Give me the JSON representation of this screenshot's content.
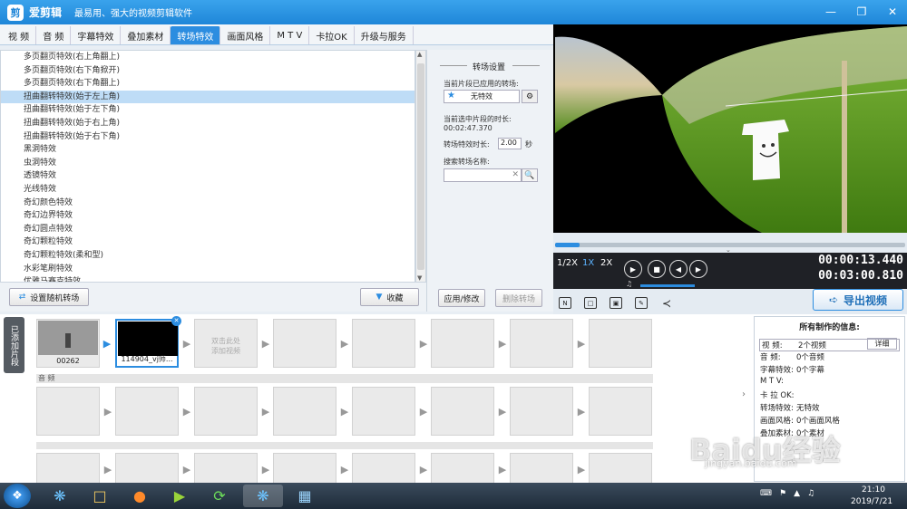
{
  "app": {
    "name": "爱剪辑",
    "slogan": "最易用、强大的视频剪辑软件",
    "logo_char": "剪"
  },
  "tabs": [
    "视 频",
    "音 频",
    "字幕特效",
    "叠加素材",
    "转场特效",
    "画面风格",
    "M T V",
    "卡拉OK",
    "升级与服务"
  ],
  "active_tab": 4,
  "effects": [
    "多页翻页特效(右上角翻上)",
    "多页翻页特效(右下角掀开)",
    "多页翻页特效(右下角翻上)",
    "扭曲翻转特效(始于左上角)",
    "扭曲翻转特效(始于左下角)",
    "扭曲翻转特效(始于右上角)",
    "扭曲翻转特效(始于右下角)",
    "黑洞特效",
    "虫洞特效",
    "透镜特效",
    "光线特效",
    "奇幻颜色特效",
    "奇幻边界特效",
    "奇幻圆点特效",
    "奇幻颗粒特效",
    "奇幻颗粒特效(柔和型)",
    "水彩笔刷特效",
    "优雅马赛克特效"
  ],
  "selected_effect": 3,
  "left_buttons": {
    "random": "设置随机转场",
    "favorite": "收藏"
  },
  "settings": {
    "title": "转场设置",
    "applied_label": "当前片段已应用的转场:",
    "applied_value": "无特效",
    "duration_label": "当前选中片段的时长:",
    "duration_value": "00:02:47.370",
    "effect_time_label": "转场特效时长:",
    "effect_time_value": "2.00",
    "effect_time_unit": "秒",
    "search_label": "搜索转场名称:",
    "search_value": "",
    "apply_button": "应用/修改",
    "delete_button": "删除转场"
  },
  "player": {
    "progress": 0.07,
    "speeds": [
      "1/2X",
      "1X",
      "2X"
    ],
    "active_speed": "1X",
    "time_current": "00:00:13.440",
    "time_total": "00:03:00.810",
    "export_label": "导出视频"
  },
  "timeline": {
    "added_label": "已添加片段",
    "clips": [
      {
        "caption": "00262"
      },
      {
        "caption": "114904_vj师..."
      }
    ],
    "placeholder": "双击此处\n添加视频",
    "audio_label": "音 频"
  },
  "info": {
    "title": "所有制作的信息:",
    "rows": [
      {
        "k": "视 频:",
        "v": "2个视频"
      },
      {
        "k": "音 频:",
        "v": "0个音频"
      },
      {
        "k": "字幕特效:",
        "v": "0个字幕"
      },
      {
        "k": "M T V:",
        "v": ""
      },
      {
        "k": "卡 拉 OK:",
        "v": ""
      },
      {
        "k": "转场特效:",
        "v": "无特效"
      },
      {
        "k": "画面风格:",
        "v": "0个画面风格"
      },
      {
        "k": "叠加素材:",
        "v": "0个素材"
      }
    ],
    "detail_button": "详细"
  },
  "taskbar": {
    "time": "21:10",
    "date": "2019/7/21"
  },
  "watermark": {
    "main": "Baidu经验",
    "sub": "jingyan.baidu.com"
  }
}
